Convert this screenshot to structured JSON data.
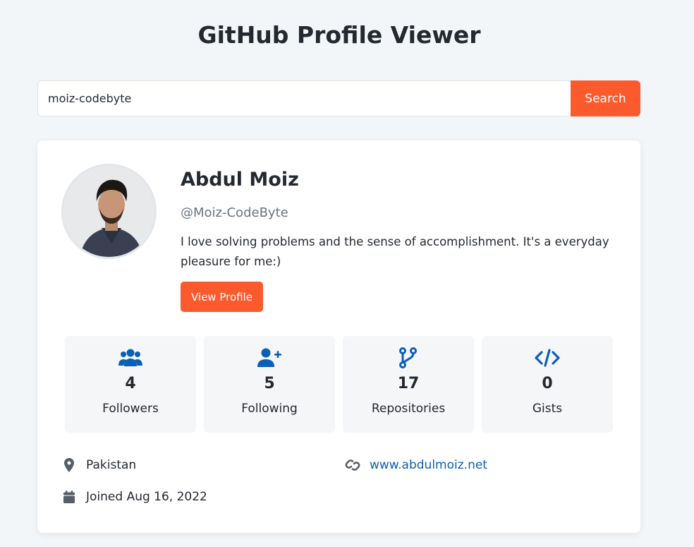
{
  "header": {
    "title": "GitHub Profile Viewer"
  },
  "search": {
    "value": "moiz-codebyte",
    "button_label": "Search"
  },
  "profile": {
    "name": "Abdul Moiz",
    "login": "@Moiz-CodeByte",
    "bio": "I love solving problems and the sense of accomplishment. It's a everyday pleasure for me:)",
    "view_button_label": "View Profile"
  },
  "stats": [
    {
      "icon": "users-icon",
      "count": "4",
      "label": "Followers"
    },
    {
      "icon": "user-plus-icon",
      "count": "5",
      "label": "Following"
    },
    {
      "icon": "code-branch-icon",
      "count": "17",
      "label": "Repositories"
    },
    {
      "icon": "code-icon",
      "count": "0",
      "label": "Gists"
    }
  ],
  "details": {
    "location": "Pakistan",
    "website": "www.abdulmoiz.net",
    "joined": "Joined Aug 16, 2022"
  },
  "colors": {
    "accent": "#fc5a2c",
    "icon_blue": "#0b5fb5",
    "background": "#f3f6f9"
  }
}
